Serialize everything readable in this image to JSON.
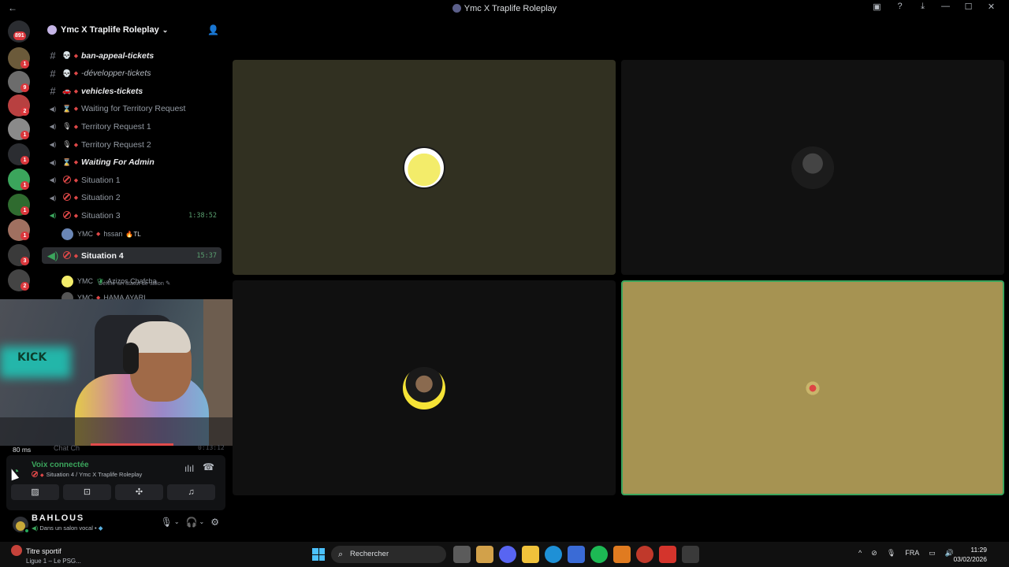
{
  "window": {
    "title": "Ymc X Traplife Roleplay"
  },
  "rail": {
    "dm_badge": "891",
    "servers": [
      {
        "badge": "1",
        "color": "#6b5a3a"
      },
      {
        "badge": "9",
        "color": "#6c6c6c"
      },
      {
        "badge": "2",
        "color": "#b84040"
      },
      {
        "badge": "1",
        "color": "#8a8a8a"
      },
      {
        "badge": "1",
        "color": "#2b2d31"
      },
      {
        "badge": "1",
        "color": "#3ba55c"
      },
      {
        "badge": "1",
        "color": "#2f6b2f"
      },
      {
        "badge": "1",
        "color": "#a07060"
      },
      {
        "badge": "3",
        "color": "#3a3a3a"
      },
      {
        "badge": "2",
        "color": "#444"
      }
    ]
  },
  "server": {
    "name": "Ymc X Traplife Roleplay",
    "channels": [
      {
        "type": "text",
        "emoji": "💀",
        "name": "ban-appeal-tickets",
        "style": "b"
      },
      {
        "type": "text",
        "emoji": "💀",
        "name": "-développer-tickets",
        "style": "i"
      },
      {
        "type": "text",
        "emoji": "🚗",
        "name": "vehicles-tickets",
        "style": "b"
      },
      {
        "type": "voice",
        "emoji": "⌛",
        "name": "Waiting for Territory Request",
        "style": ""
      },
      {
        "type": "voice",
        "emoji": "🎙",
        "name": "Territory Request 1",
        "style": ""
      },
      {
        "type": "voice",
        "emoji": "🎙",
        "name": "Territory Request 2",
        "style": ""
      },
      {
        "type": "voice",
        "emoji": "⌛",
        "name": "Waiting For Admin",
        "style": "b"
      },
      {
        "type": "voice-no",
        "emoji": "",
        "name": "Situation 1",
        "style": ""
      },
      {
        "type": "voice-no",
        "emoji": "",
        "name": "Situation 2",
        "style": ""
      },
      {
        "type": "voice-no",
        "emoji": "",
        "name": "Situation 3",
        "style": "",
        "time": "1:38:52"
      }
    ],
    "situation3_member": {
      "prefix": "YMC",
      "name": "hssan",
      "tag": "🔥TL"
    },
    "active_channel": {
      "name": "Situation 4",
      "time": "15:37",
      "subtitle": "Définir un statut de salon"
    },
    "situation4_members": [
      {
        "prefix": "YMC",
        "name": "Azizos Chafcha"
      },
      {
        "prefix": "YMC",
        "name": "HAMA AYARI"
      }
    ]
  },
  "voice": {
    "ping": "80 ms",
    "chat_label": "Chat Ch",
    "chat_time": "0:13:12",
    "status": "Voix connectée",
    "location": "Situation 4 / Ymc X Traplife Roleplay",
    "buttons": [
      "camera-off",
      "screen-share",
      "activities",
      "soundboard"
    ]
  },
  "user": {
    "name": "BAHLOUS",
    "status": "Dans un salon vocal"
  },
  "taskbar": {
    "weather_title": "Titre sportif",
    "weather_sub": "Ligue 1 – Le PSG...",
    "search_placeholder": "Rechercher",
    "lang": "FRA",
    "time": "11:29",
    "date": "03/02/2026",
    "app_colors": [
      "#5b5b5b",
      "#d2a14a",
      "#5865f2",
      "#f0c23b",
      "#1e90d6",
      "#3a6bd6",
      "#1db954",
      "#e07b20",
      "#c0392b",
      "#d4342c",
      "#3a3a3a"
    ]
  }
}
